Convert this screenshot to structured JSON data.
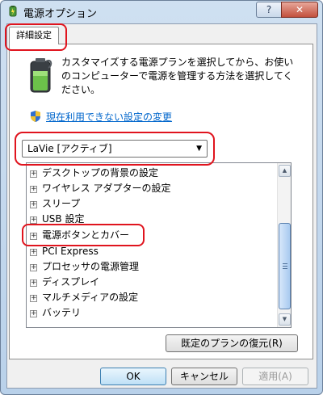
{
  "window": {
    "title": "電源オプション",
    "help_label": "?",
    "close_label": "✕"
  },
  "tabs": [
    {
      "label": "詳細設定"
    }
  ],
  "description": "カスタマイズする電源プランを選択してから、お使いのコンピューターで電源を管理する方法を選択してください。",
  "change_link": "現在利用できない設定の変更",
  "plan_select": {
    "value": "LaVie [アクティブ]",
    "arrow": "▼"
  },
  "tree": {
    "expander": "+",
    "items": [
      {
        "label": "デスクトップの背景の設定"
      },
      {
        "label": "ワイヤレス アダプターの設定"
      },
      {
        "label": "スリープ"
      },
      {
        "label": "USB 設定"
      },
      {
        "label": "電源ボタンとカバー"
      },
      {
        "label": "PCI Express"
      },
      {
        "label": "プロセッサの電源管理"
      },
      {
        "label": "ディスプレイ"
      },
      {
        "label": "マルチメディアの設定"
      },
      {
        "label": "バッテリ"
      }
    ],
    "scroll_up": "▲",
    "scroll_down": "▼"
  },
  "buttons": {
    "restore": "既定のプランの復元(R)",
    "ok": "OK",
    "cancel": "キャンセル",
    "apply": "適用(A)"
  },
  "colors": {
    "highlight": "#e0141e",
    "link": "#0066cc"
  }
}
